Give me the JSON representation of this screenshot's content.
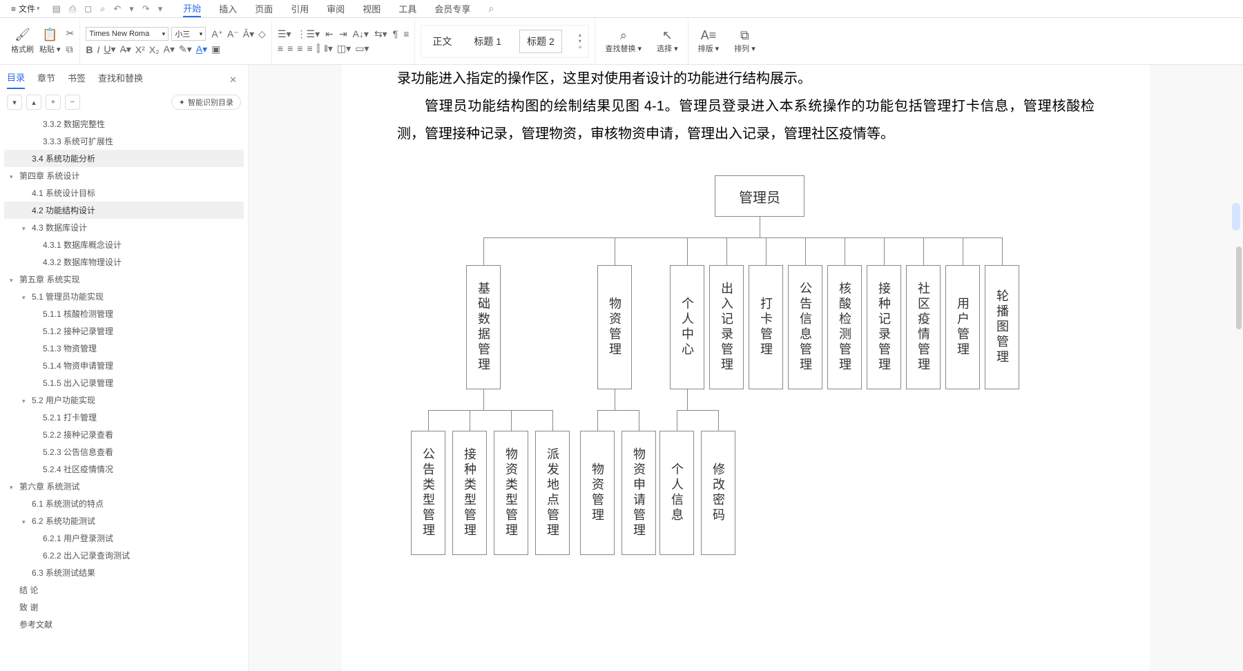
{
  "menubar": {
    "file": "文件",
    "tabs": [
      "开始",
      "插入",
      "页面",
      "引用",
      "审阅",
      "视图",
      "工具",
      "会员专享"
    ],
    "activeTab": 0
  },
  "ribbon": {
    "format_painter": "格式刷",
    "paste": "粘贴",
    "font_name": "Times New Roma",
    "font_size": "小三",
    "styles": {
      "body": "正文",
      "h1": "标题 1",
      "h2": "标题 2"
    },
    "find_replace": "查找替换",
    "select": "选择",
    "layout": "排版",
    "arrange": "排列"
  },
  "sidebar": {
    "tabs": [
      "目录",
      "章节",
      "书签",
      "查找和替换"
    ],
    "smart": "智能识别目录",
    "toc": [
      {
        "lvl": 3,
        "t": "3.3.2 数据完整性"
      },
      {
        "lvl": 3,
        "t": "3.3.3 系统可扩展性"
      },
      {
        "lvl": 2,
        "t": "3.4 系统功能分析",
        "sel": true
      },
      {
        "lvl": 1,
        "t": "第四章 系统设计",
        "caret": true
      },
      {
        "lvl": 2,
        "t": "4.1 系统设计目标"
      },
      {
        "lvl": 2,
        "t": "4.2 功能结构设计",
        "sel": true
      },
      {
        "lvl": 2,
        "t": "4.3 数据库设计",
        "caret": true
      },
      {
        "lvl": 3,
        "t": "4.3.1 数据库概念设计"
      },
      {
        "lvl": 3,
        "t": "4.3.2 数据库物理设计"
      },
      {
        "lvl": 1,
        "t": "第五章 系统实现",
        "caret": true
      },
      {
        "lvl": 2,
        "t": "5.1 管理员功能实现",
        "caret": true
      },
      {
        "lvl": 3,
        "t": "5.1.1 核酸检测管理"
      },
      {
        "lvl": 3,
        "t": "5.1.2 接种记录管理"
      },
      {
        "lvl": 3,
        "t": "5.1.3 物资管理"
      },
      {
        "lvl": 3,
        "t": "5.1.4 物资申请管理"
      },
      {
        "lvl": 3,
        "t": "5.1.5 出入记录管理"
      },
      {
        "lvl": 2,
        "t": "5.2 用户功能实现",
        "caret": true
      },
      {
        "lvl": 3,
        "t": "5.2.1 打卡管理"
      },
      {
        "lvl": 3,
        "t": "5.2.2 接种记录查看"
      },
      {
        "lvl": 3,
        "t": "5.2.3 公告信息查看"
      },
      {
        "lvl": 3,
        "t": "5.2.4 社区疫情情况"
      },
      {
        "lvl": 1,
        "t": "第六章 系统测试",
        "caret": true
      },
      {
        "lvl": 2,
        "t": "6.1 系统测试的特点"
      },
      {
        "lvl": 2,
        "t": "6.2 系统功能测试",
        "caret": true
      },
      {
        "lvl": 3,
        "t": "6.2.1 用户登录测试"
      },
      {
        "lvl": 3,
        "t": "6.2.2 出入记录查询测试"
      },
      {
        "lvl": 2,
        "t": "6.3 系统测试结果"
      },
      {
        "lvl": 1,
        "t": "结 论"
      },
      {
        "lvl": 1,
        "t": "致 谢"
      },
      {
        "lvl": 1,
        "t": "参考文献"
      }
    ]
  },
  "doc": {
    "p1": "录功能进入指定的操作区，这里对使用者设计的功能进行结构展示。",
    "p2": "管理员功能结构图的绘制结果见图 4-1。管理员登录进入本系统操作的功能包括管理打卡信息，管理核酸检测，管理接种记录，管理物资，审核物资申请，管理出入记录，管理社区疫情等。"
  },
  "diagram": {
    "root": "管理员",
    "level2": [
      "基础数据管理",
      "物资管理",
      "个人中心",
      "出入记录管理",
      "打卡管理",
      "公告信息管理",
      "核酸检测管理",
      "接种记录管理",
      "社区疫情管理",
      "用户管理",
      "轮播图管理"
    ],
    "level3a": [
      "公告类型管理",
      "接种类型管理",
      "物资类型管理",
      "派发地点管理"
    ],
    "level3b": [
      "物资管理",
      "物资申请管理"
    ],
    "level3c": [
      "个人信息",
      "修改密码"
    ]
  }
}
